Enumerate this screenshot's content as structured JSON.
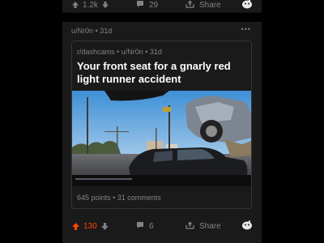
{
  "feed": {
    "previous_post": {
      "vote_count": "1.2k",
      "comment_count": "29",
      "share_label": "Share"
    },
    "post": {
      "author": "u/Nr0n",
      "age": "31d",
      "separator": "•",
      "more_label": "•••",
      "crosspost": {
        "subreddit": "r/dashcams",
        "author": "u/Nr0n",
        "age": "31d",
        "title": "Your front seat for a gnarly red light runner accident",
        "points": "645 points",
        "comments": "31 comments"
      },
      "vote_count": "130",
      "comment_count": "6",
      "share_label": "Share"
    }
  },
  "colors": {
    "upvote_active": "#ff4500",
    "muted": "#818384",
    "card_bg": "#1a1a1b",
    "page_bg": "#000000",
    "title": "#ffffff"
  },
  "icons": [
    "upvote-icon",
    "downvote-icon",
    "comment-icon",
    "share-icon",
    "award-icon",
    "more-icon"
  ]
}
